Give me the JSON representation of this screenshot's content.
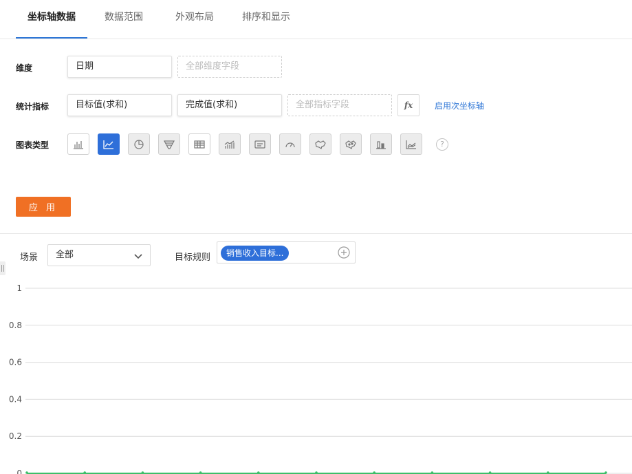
{
  "tabs": [
    {
      "label": "坐标轴数据",
      "active": true
    },
    {
      "label": "数据范围",
      "active": false
    },
    {
      "label": "外观布局",
      "active": false
    },
    {
      "label": "排序和显示",
      "active": false
    }
  ],
  "dimension": {
    "label": "维度",
    "field": "日期",
    "placeholder": "全部维度字段"
  },
  "metrics": {
    "label": "统计指标",
    "fields": [
      "目标值(求和)",
      "完成值(求和)"
    ],
    "placeholder": "全部指标字段",
    "fx_label": "fx",
    "secondary_axis_link": "启用次坐标轴"
  },
  "chart_types": {
    "label": "图表类型",
    "items": [
      {
        "icon": "bar-chart-icon",
        "style": "white"
      },
      {
        "icon": "line-chart-icon",
        "style": "active"
      },
      {
        "icon": "pie-chart-icon",
        "style": "gray"
      },
      {
        "icon": "funnel-chart-icon",
        "style": "gray"
      },
      {
        "icon": "table-icon",
        "style": "white"
      },
      {
        "icon": "combo-chart-icon",
        "style": "gray"
      },
      {
        "icon": "text-card-icon",
        "style": "gray"
      },
      {
        "icon": "gauge-icon",
        "style": "gray"
      },
      {
        "icon": "map-icon",
        "style": "gray"
      },
      {
        "icon": "scatter-map-icon",
        "style": "gray"
      },
      {
        "icon": "stacked-bar-icon",
        "style": "gray"
      },
      {
        "icon": "area-chart-icon",
        "style": "gray"
      }
    ],
    "help_icon": "?"
  },
  "apply_button": "应 用",
  "filters": {
    "scene_label": "场景",
    "scene_value": "全部",
    "rule_label": "目标规则",
    "rule_tag": "销售收入目标..."
  },
  "colors": {
    "accent": "#2e6fd9",
    "apply": "#f07024",
    "series_line": "#3dbf6a"
  },
  "chart_data": {
    "type": "line",
    "y_ticks": [
      "1",
      "0.8",
      "0.6",
      "0.4",
      "0.2",
      "0"
    ],
    "ylim": [
      0,
      1
    ],
    "grid": true,
    "series": [
      {
        "values": [
          0,
          0,
          0,
          0,
          0,
          0,
          0,
          0,
          0,
          0,
          0
        ]
      }
    ]
  }
}
